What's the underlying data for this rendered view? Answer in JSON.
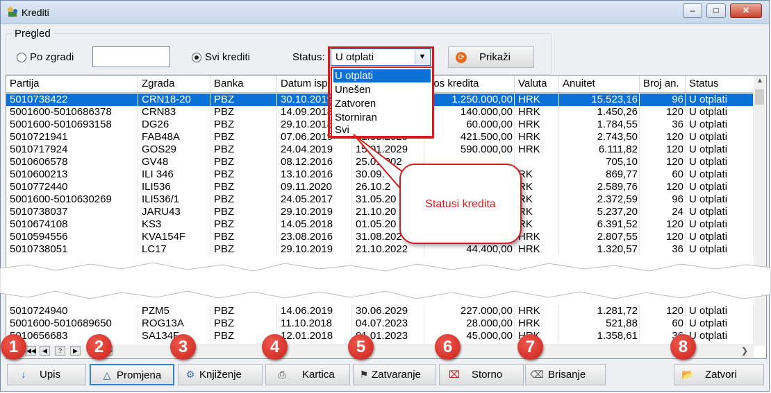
{
  "window": {
    "title": "Krediti",
    "controls": {
      "minimize": "–",
      "maximize": "□",
      "close": "✕"
    }
  },
  "filter": {
    "group_label": "Pregled",
    "radio_po_zgradi": "Po zgradi",
    "radio_svi_krediti": "Svi krediti",
    "selected_radio": "Svi krediti",
    "zgrada_input_value": "",
    "status_label": "Status:",
    "status_value": "U otplati",
    "status_options": [
      "U otplati",
      "Unešen",
      "Zatvoren",
      "Storniran",
      "Svi"
    ],
    "prikazi_button": "Prikaži"
  },
  "table": {
    "columns": [
      "Partija",
      "Zgrada",
      "Banka",
      "Datum isp",
      "",
      "nos kredita",
      "Valuta",
      "Anuitet",
      "Broj an.",
      "Status"
    ],
    "rows": [
      [
        "5010738422",
        "CRN18-20",
        "PBZ",
        "30.10.2019",
        "",
        "1.250.000,00",
        "HRK",
        "15.523,16",
        "96",
        "U otplati"
      ],
      [
        "5001600-5010686378",
        "CRN83",
        "PBZ",
        "14.09.2018",
        "",
        "140.000,00",
        "HRK",
        "1.450,26",
        "120",
        "U otplati"
      ],
      [
        "5001600-5010693158",
        "DG26",
        "PBZ",
        "29.10.2018",
        "",
        "60.000,00",
        "HRK",
        "1.784,55",
        "36",
        "U otplati"
      ],
      [
        "5010721941",
        "FAB48A",
        "PBZ",
        "07.06.2019",
        "31.05.2029",
        "421.500,00",
        "HRK",
        "2.743,50",
        "120",
        "U otplati"
      ],
      [
        "5010717924",
        "GOS29",
        "PBZ",
        "24.04.2019",
        "15.01.2029",
        "590.000,00",
        "HRK",
        "6.111,82",
        "120",
        "U otplati"
      ],
      [
        "5010606578",
        "GV48",
        "PBZ",
        "08.12.2016",
        "25.01.202",
        "",
        "",
        "705,10",
        "120",
        "U otplati"
      ],
      [
        "5010600213",
        "ILI 346",
        "PBZ",
        "13.10.2016",
        "30.09.",
        "",
        "RK",
        "869,77",
        "60",
        "U otplati"
      ],
      [
        "5010772440",
        "ILI536",
        "PBZ",
        "09.11.2020",
        "26.10.2",
        "",
        "RK",
        "2.589,76",
        "120",
        "U otplati"
      ],
      [
        "5001600-5010630269",
        "ILI536/1",
        "PBZ",
        "24.05.2017",
        "31.05.20",
        "",
        "RK",
        "2.372,59",
        "96",
        "U otplati"
      ],
      [
        "5010738037",
        "JARU43",
        "PBZ",
        "29.10.2019",
        "21.10.20",
        "",
        "RK",
        "5.237,20",
        "24",
        "U otplati"
      ],
      [
        "5010674108",
        "KS3",
        "PBZ",
        "14.05.2018",
        "01.05.20",
        "",
        "RK",
        "6.391,52",
        "120",
        "U otplati"
      ],
      [
        "5010594556",
        "KVA154F",
        "PBZ",
        "23.08.2016",
        "31.08.2026",
        "253.000,00",
        "HRK",
        "2.807,55",
        "120",
        "U otplati"
      ],
      [
        "5010738051",
        "LC17",
        "PBZ",
        "29.10.2019",
        "21.10.2022",
        "44.400,00",
        "HRK",
        "1.320,57",
        "36",
        "U otplati"
      ]
    ],
    "rows_bottom": [
      [
        "5010724940",
        "PZM5",
        "PBZ",
        "14.06.2019",
        "30.06.2029",
        "227.000,00",
        "HRK",
        "1.281,72",
        "120",
        "U otplati"
      ],
      [
        "5001600-5010689650",
        "ROG13A",
        "PBZ",
        "11.10.2018",
        "04.07.2023",
        "28.000,00",
        "HRK",
        "521,88",
        "60",
        "U otplati"
      ],
      [
        "5010656683",
        "SA134F",
        "PBZ",
        "12.01.2018",
        "01.01.2023",
        "45.000,00",
        "HRK",
        "1.358,61",
        "36",
        "U otplati"
      ]
    ],
    "nav_buttons": [
      "◀◀",
      "◀",
      "?",
      "▶",
      "▶▶"
    ]
  },
  "callout": {
    "text": "Statusi kredita"
  },
  "toolbar": {
    "buttons": [
      {
        "label": "Upis",
        "icon": "arrow-down-plus-icon"
      },
      {
        "label": "Promjena",
        "icon": "triangle-icon"
      },
      {
        "label": "Knjiženje",
        "icon": "gears-icon"
      },
      {
        "label": "Kartica",
        "icon": "printer-icon"
      },
      {
        "label": "Zatvaranje",
        "icon": "checkered-flag-icon"
      },
      {
        "label": "Storno",
        "icon": "cross-box-icon"
      },
      {
        "label": "Brisanje",
        "icon": "eraser-icon"
      },
      {
        "label": "Zatvori",
        "icon": "folder-icon"
      }
    ]
  },
  "badges": [
    "1",
    "2",
    "3",
    "4",
    "5",
    "6",
    "7",
    "8"
  ],
  "colors": {
    "selection": "#0b71d7",
    "highlight": "#d81c1c"
  }
}
